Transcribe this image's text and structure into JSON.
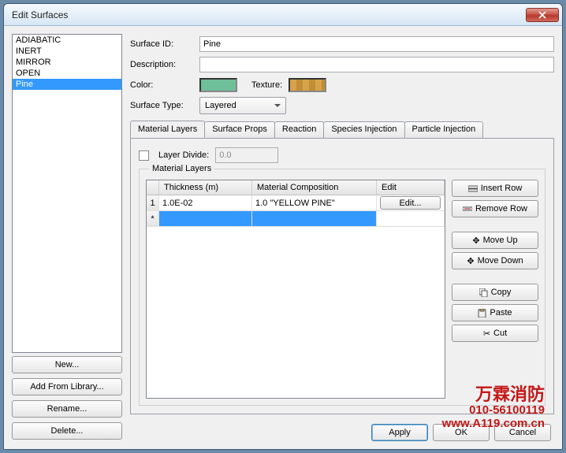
{
  "window": {
    "title": "Edit Surfaces"
  },
  "surfaces": {
    "items": [
      "ADIABATIC",
      "INERT",
      "MIRROR",
      "OPEN",
      "Pine"
    ],
    "selected_index": 4
  },
  "list_buttons": {
    "new": "New...",
    "add_from_library": "Add From Library...",
    "rename": "Rename...",
    "delete": "Delete..."
  },
  "form": {
    "surface_id_label": "Surface ID:",
    "surface_id_value": "Pine",
    "description_label": "Description:",
    "description_value": "",
    "color_label": "Color:",
    "color_value": "#6fbf9a",
    "texture_label": "Texture:",
    "texture_value": "#d6a24a",
    "surface_type_label": "Surface Type:",
    "surface_type_value": "Layered"
  },
  "tabs": {
    "items": [
      "Material Layers",
      "Surface Props",
      "Reaction",
      "Species Injection",
      "Particle Injection"
    ],
    "active_index": 0
  },
  "material_layers": {
    "layer_divide_label": "Layer Divide:",
    "layer_divide_value": "0.0",
    "legend": "Material Layers",
    "columns": [
      "Thickness (m)",
      "Material Composition",
      "Edit"
    ],
    "rows": [
      {
        "index": "1",
        "thickness": "1.0E-02",
        "composition": "1.0 \"YELLOW PINE\"",
        "edit_label": "Edit..."
      }
    ],
    "new_row_marker": "*",
    "buttons": {
      "insert_row": "Insert Row",
      "remove_row": "Remove Row",
      "move_up": "Move Up",
      "move_down": "Move Down",
      "copy": "Copy",
      "paste": "Paste",
      "cut": "Cut"
    }
  },
  "dialog_buttons": {
    "apply": "Apply",
    "ok": "OK",
    "cancel": "Cancel"
  },
  "watermark": {
    "zh": "万霖消防",
    "line1": "010-56100119",
    "line2": "www.A119.com.cn"
  }
}
